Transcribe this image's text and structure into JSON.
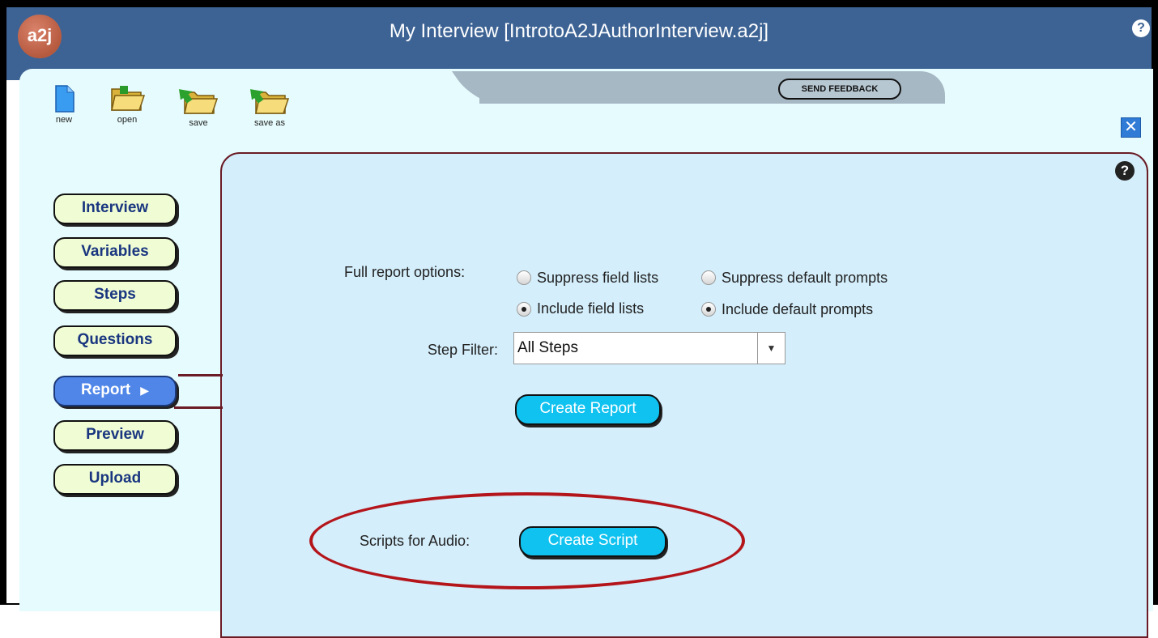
{
  "app": {
    "logo": "a2j",
    "title": "My Interview [IntrotoA2JAuthorInterview.a2j]",
    "help_glyph": "?"
  },
  "toolbar": {
    "new_label": "new",
    "open_label": "open",
    "save_label": "save",
    "save_as_label": "save as",
    "feedback_label": "SEND FEEDBACK",
    "close_glyph": "✕"
  },
  "nav": {
    "items": [
      {
        "label": "Interview"
      },
      {
        "label": "Variables"
      },
      {
        "label": "Steps"
      },
      {
        "label": "Questions"
      },
      {
        "label": "Report",
        "active": true
      },
      {
        "label": "Preview"
      },
      {
        "label": "Upload"
      }
    ],
    "active_arrow": "▶"
  },
  "report": {
    "full_options_label": "Full report options:",
    "suppress_field_lists": "Suppress field lists",
    "suppress_default_prompts": "Suppress default prompts",
    "include_field_lists": "Include field lists",
    "include_default_prompts": "Include default prompts",
    "selected_field_option": "Include field lists",
    "selected_prompt_option": "Include default prompts",
    "step_filter_label": "Step Filter:",
    "step_filter_value": "All Steps",
    "create_report_label": "Create Report",
    "scripts_label": "Scripts for Audio:",
    "create_script_label": "Create Script"
  },
  "colors": {
    "titlebar": "#3d6394",
    "panel": "#d4eefb",
    "active_nav": "#4f86e8",
    "action_button": "#10c2f0",
    "highlight_oval": "#b4151b"
  },
  "icons": [
    "new-file-icon",
    "open-folder-icon",
    "save-icon",
    "save-as-icon",
    "help-icon",
    "close-icon",
    "dropdown-arrow-icon"
  ]
}
